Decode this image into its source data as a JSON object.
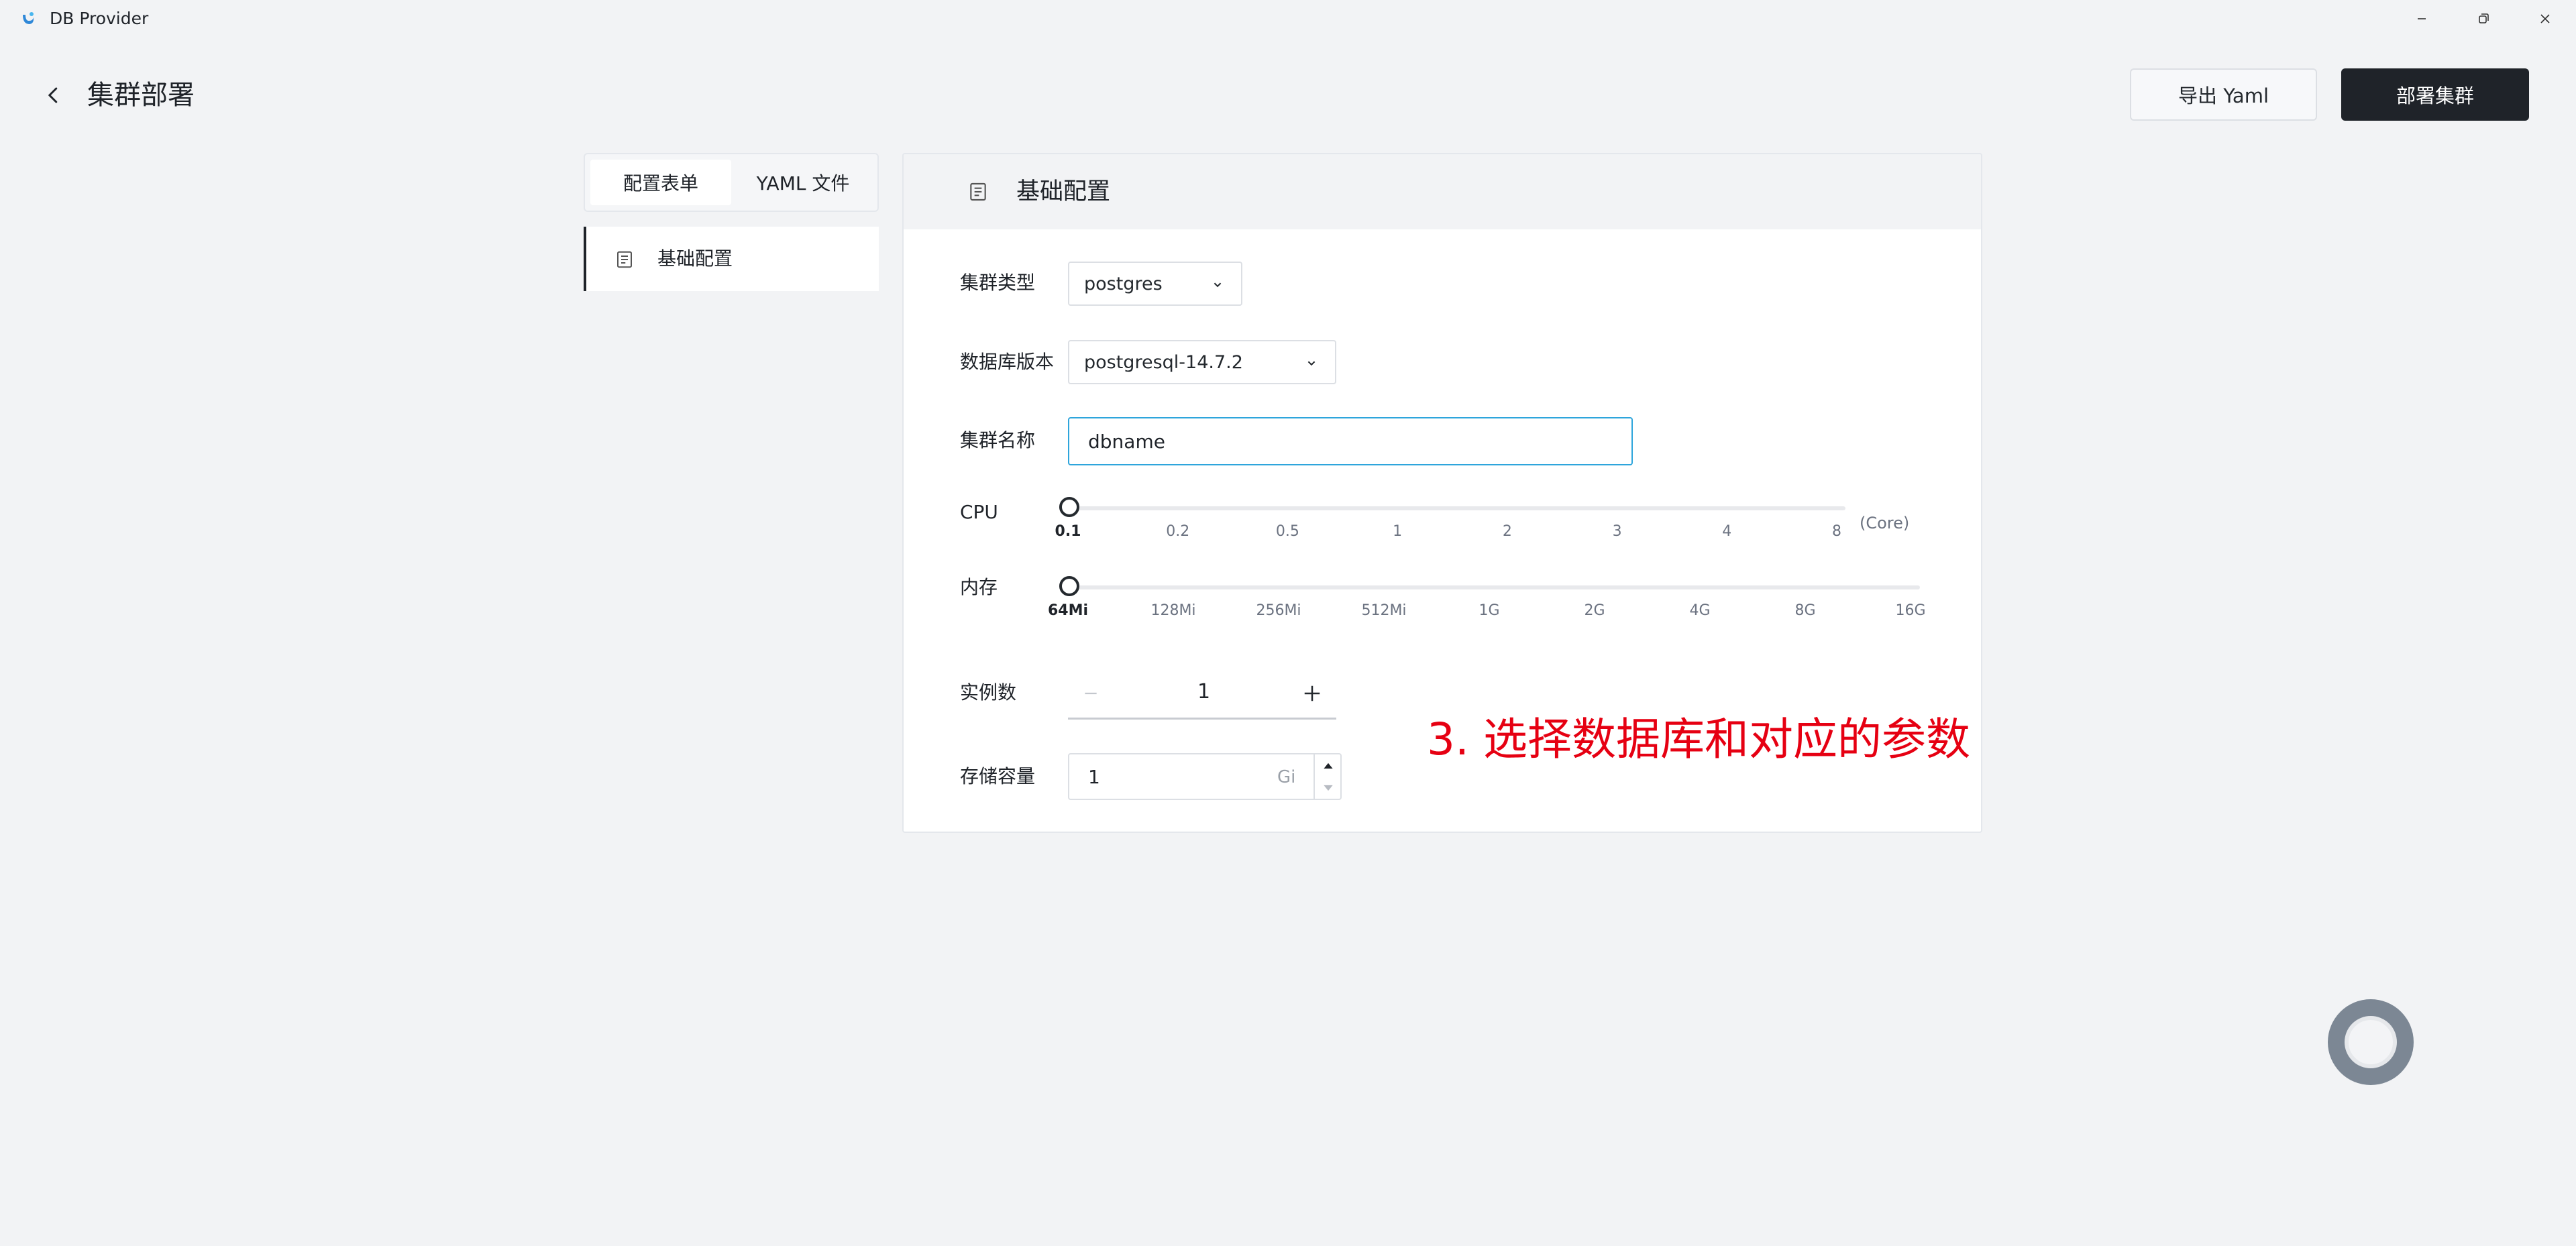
{
  "window": {
    "title": "DB Provider"
  },
  "header": {
    "title": "集群部署",
    "export_label": "导出 Yaml",
    "deploy_label": "部署集群"
  },
  "tabs": [
    {
      "label": "配置表单",
      "active": true
    },
    {
      "label": "YAML 文件",
      "active": false
    }
  ],
  "nav": {
    "items": [
      {
        "label": "基础配置",
        "active": true
      }
    ]
  },
  "panel": {
    "title": "基础配置"
  },
  "form": {
    "cluster_type": {
      "label": "集群类型",
      "value": "postgres"
    },
    "db_version": {
      "label": "数据库版本",
      "value": "postgresql-14.7.2"
    },
    "cluster_name": {
      "label": "集群名称",
      "value": "dbname"
    },
    "cpu": {
      "label": "CPU",
      "ticks": [
        "0.1",
        "0.2",
        "0.5",
        "1",
        "2",
        "3",
        "4",
        "8"
      ],
      "value": "0.1",
      "unit": "(Core)"
    },
    "memory": {
      "label": "内存",
      "ticks": [
        "64Mi",
        "128Mi",
        "256Mi",
        "512Mi",
        "1G",
        "2G",
        "4G",
        "8G",
        "16G"
      ],
      "value": "64Mi"
    },
    "replicas": {
      "label": "实例数",
      "value": "1"
    },
    "storage": {
      "label": "存储容量",
      "value": "1",
      "unit": "Gi"
    }
  },
  "annotation": {
    "text": "3. 选择数据库和对应的参数",
    "color": "#e60012"
  },
  "icons": {
    "logo": "db-provider-logo-icon",
    "back": "back-arrow-icon",
    "doc": "document-icon"
  }
}
